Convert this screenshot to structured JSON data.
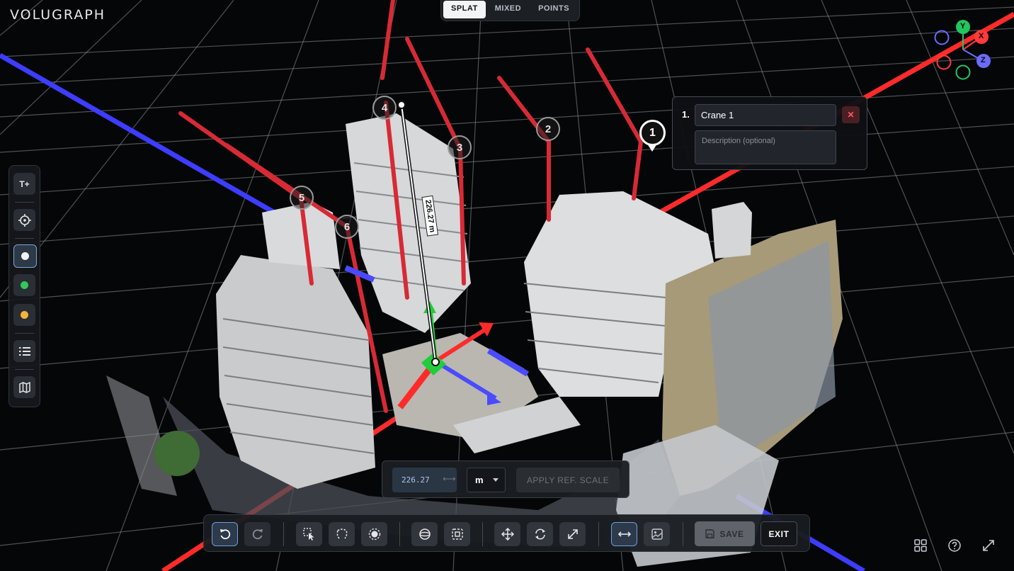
{
  "app": {
    "logo": "VOLUGRAPH"
  },
  "mode_tabs": [
    {
      "label": "SPLAT",
      "active": true
    },
    {
      "label": "MIXED",
      "active": false
    },
    {
      "label": "POINTS",
      "active": false
    }
  ],
  "left_rail": {
    "text_tool_label": "T+",
    "color_swatches": [
      "#f2f2f2",
      "#34c759",
      "#f5b33c"
    ],
    "selected_swatch": "#f2f2f2"
  },
  "markers": [
    "1",
    "2",
    "3",
    "4",
    "5",
    "6"
  ],
  "measurement": {
    "label": "226.27 m"
  },
  "annotation": {
    "number": "1.",
    "name": "Crane 1",
    "description_placeholder": "Description (optional)"
  },
  "axis_gizmo": {
    "y": "Y",
    "x": "X",
    "z": "Z",
    "colors": {
      "x": "#ff3b3b",
      "y": "#22c55e",
      "z": "#6b6bff"
    }
  },
  "scale_panel": {
    "value": "226.27",
    "unit": "m",
    "apply_label": "APPLY REF. SCALE"
  },
  "toolbar": {
    "save_label": "SAVE",
    "exit_label": "EXIT"
  }
}
